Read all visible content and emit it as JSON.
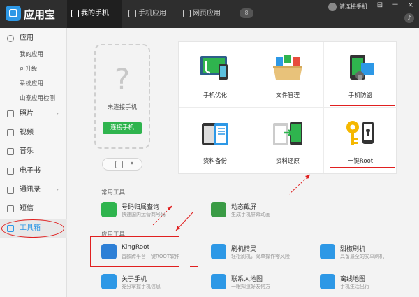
{
  "app": {
    "title": "应用宝"
  },
  "tabs": [
    {
      "label": "我的手机",
      "icon": "phone-icon"
    },
    {
      "label": "手机应用",
      "icon": "mail-icon"
    },
    {
      "label": "网页应用",
      "icon": "browser-icon"
    }
  ],
  "header": {
    "pill": "8",
    "login": "请连接手机",
    "controls": [
      "⊟",
      "－",
      "×"
    ]
  },
  "sidebar": {
    "app_label": "应用",
    "app_subitems": [
      "我的应用",
      "可升级",
      "系统应用",
      "山寨应用检测"
    ],
    "items": [
      {
        "label": "照片",
        "icon": "photo-icon",
        "arrow": "›"
      },
      {
        "label": "视频",
        "icon": "video-icon",
        "arrow": ""
      },
      {
        "label": "音乐",
        "icon": "music-icon",
        "arrow": ""
      },
      {
        "label": "电子书",
        "icon": "ebook-icon",
        "arrow": ""
      },
      {
        "label": "通讯录",
        "icon": "contacts-icon",
        "arrow": "›"
      },
      {
        "label": "短信",
        "icon": "sms-icon",
        "arrow": ""
      },
      {
        "label": "工具箱",
        "icon": "toolbox-icon",
        "arrow": ""
      }
    ]
  },
  "phone": {
    "status": "未连接手机",
    "connect_label": "连接手机",
    "question": "?"
  },
  "grid": [
    {
      "label": "手机优化",
      "icon": "phone-optimize-icon"
    },
    {
      "label": "文件管理",
      "icon": "file-manager-icon"
    },
    {
      "label": "手机防盗",
      "icon": "anti-theft-icon"
    },
    {
      "label": "资料备份",
      "icon": "backup-icon"
    },
    {
      "label": "资料还原",
      "icon": "restore-icon"
    },
    {
      "label": "一键Root",
      "icon": "root-key-icon"
    }
  ],
  "common_tools": {
    "label": "常用工具",
    "items": [
      {
        "name": "号码归属查询",
        "desc": "快速国内运营商号码",
        "color": "#2fb44e",
        "icon": "phone-lookup-icon"
      },
      {
        "name": "动态截屏",
        "desc": "生成手机屏幕动画",
        "color": "#3a9b45",
        "icon": "screenshot-icon"
      }
    ]
  },
  "app_tools": {
    "label": "应用工具",
    "items": [
      {
        "name": "KingRoot",
        "desc": "首款跨平台一键ROOT软件",
        "color": "#2d7fd6",
        "icon": "kingroot-icon"
      },
      {
        "name": "刷机精灵",
        "desc": "轻松刷机，简单操作零风险",
        "color": "#2d98e6",
        "icon": "flash-wizard-icon"
      },
      {
        "name": "甜椒刷机",
        "desc": "具备最全的安卓刷机",
        "color": "#2d98e6",
        "icon": "pepper-flash-icon"
      },
      {
        "name": "关于手机",
        "desc": "充分掌握手机信息",
        "color": "#2d98e6",
        "icon": "phone-info-icon"
      },
      {
        "name": "联系人地图",
        "desc": "一眼知道好友何方",
        "color": "#2d98e6",
        "icon": "contact-map-icon"
      },
      {
        "name": "离线地图",
        "desc": "手机生活出行",
        "color": "#2d98e6",
        "icon": "offline-map-icon"
      }
    ]
  }
}
